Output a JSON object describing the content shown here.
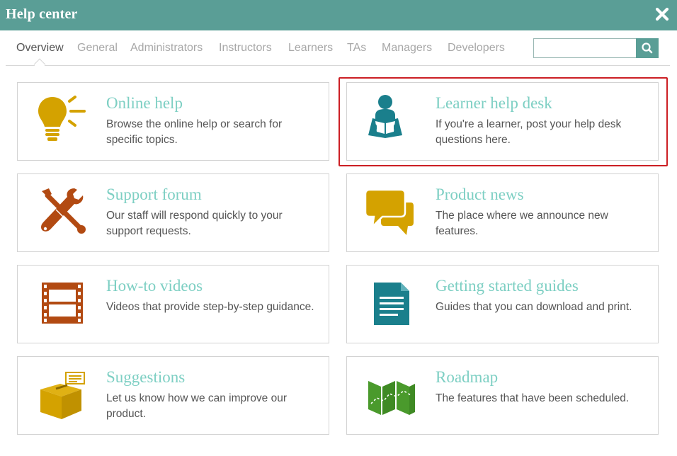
{
  "window": {
    "title": "Help center"
  },
  "tabs": [
    {
      "label": "Overview"
    },
    {
      "label": "General"
    },
    {
      "label": "Administrators"
    },
    {
      "label": "Instructors"
    },
    {
      "label": "Learners"
    },
    {
      "label": "TAs"
    },
    {
      "label": "Managers"
    },
    {
      "label": "Developers"
    }
  ],
  "search": {
    "value": "",
    "placeholder": ""
  },
  "cards": [
    {
      "title": "Online help",
      "description": "Browse the online help or search for specific topics.",
      "icon": "lightbulb-icon"
    },
    {
      "title": "Learner help desk",
      "description": "If you're a learner, post your help desk questions here.",
      "icon": "reader-icon"
    },
    {
      "title": "Support forum",
      "description": "Our staff will respond quickly to your support requests.",
      "icon": "tools-icon"
    },
    {
      "title": "Product news",
      "description": "The place where we announce new features.",
      "icon": "chat-bubbles-icon"
    },
    {
      "title": "How-to videos",
      "description": "Videos that provide step-by-step guidance.",
      "icon": "film-strip-icon"
    },
    {
      "title": "Getting started guides",
      "description": "Guides that you can download and print.",
      "icon": "document-icon"
    },
    {
      "title": "Suggestions",
      "description": "Let us know how we can improve our product.",
      "icon": "suggestion-box-icon"
    },
    {
      "title": "Roadmap",
      "description": "The features that have been scheduled.",
      "icon": "map-icon"
    }
  ],
  "colors": {
    "header": "#5a9e96",
    "card_title": "#7dcfc3",
    "highlight": "#cc1f24",
    "icon_yellow": "#d4a200",
    "icon_teal": "#1a7f8c",
    "icon_brown": "#b24a12",
    "icon_green": "#4a9a2c"
  }
}
